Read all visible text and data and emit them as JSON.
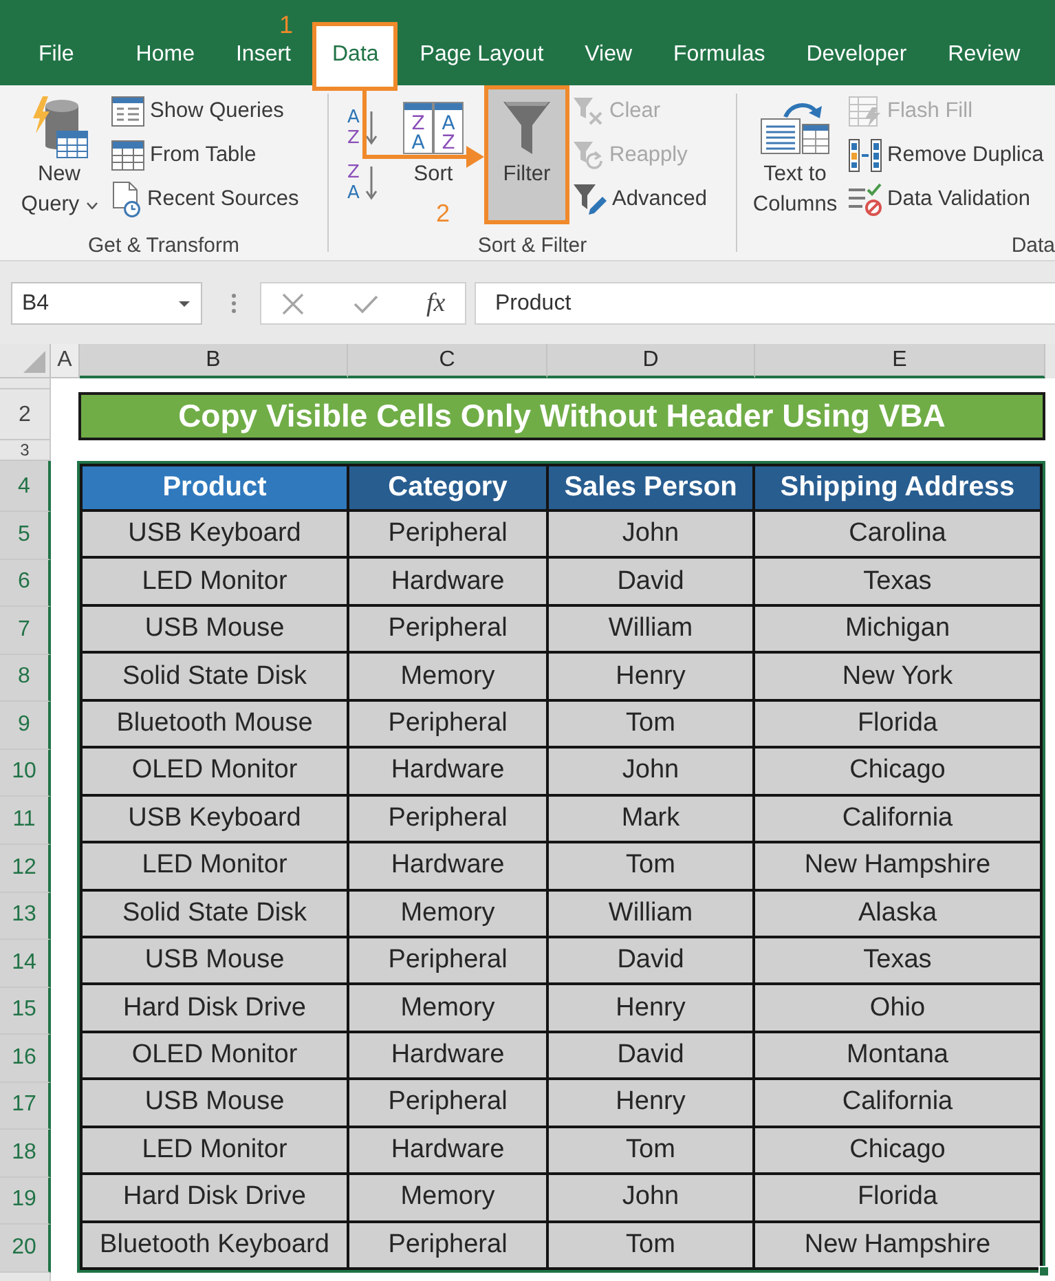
{
  "tabs": [
    {
      "label": "File",
      "selected": false,
      "highlighted": false
    },
    {
      "label": "Home",
      "selected": false,
      "highlighted": false
    },
    {
      "label": "Insert",
      "selected": false,
      "highlighted": false
    },
    {
      "label": "Data",
      "selected": true,
      "highlighted": true
    },
    {
      "label": "Page Layout",
      "selected": false,
      "highlighted": false
    },
    {
      "label": "View",
      "selected": false,
      "highlighted": false
    },
    {
      "label": "Formulas",
      "selected": false,
      "highlighted": false
    },
    {
      "label": "Developer",
      "selected": false,
      "highlighted": false
    },
    {
      "label": "Review",
      "selected": false,
      "highlighted": false
    }
  ],
  "ribbon": {
    "groups": [
      {
        "label": "Get & Transform",
        "controls": [
          {
            "kind": "new_query",
            "lines": [
              "New",
              "Query"
            ],
            "dropdown": true,
            "highlighted": false
          },
          {
            "kind": "stack",
            "buttons": [
              {
                "kind": "show_queries",
                "label": "Show Queries",
                "disabled": false
              },
              {
                "kind": "from_table",
                "label": "From Table",
                "disabled": false
              },
              {
                "kind": "recent_sources",
                "label": "Recent Sources",
                "disabled": false
              }
            ]
          }
        ]
      },
      {
        "label": "Sort & Filter",
        "controls": [
          {
            "kind": "sort_stack",
            "buttons": [
              {
                "kind": "sort_ascending",
                "glyphs": [
                  "A",
                  "Z"
                ]
              },
              {
                "kind": "sort_descending",
                "glyphs": [
                  "Z",
                  "A"
                ]
              }
            ]
          },
          {
            "kind": "sort",
            "glyphs": [
              "Z",
              "A",
              "A",
              "Z"
            ],
            "lines": [
              "Sort"
            ],
            "dropdown": false,
            "highlighted": false
          },
          {
            "kind": "filter",
            "lines": [
              "Filter"
            ],
            "dropdown": false,
            "highlighted": true
          },
          {
            "kind": "stack",
            "buttons": [
              {
                "kind": "clear",
                "label": "Clear",
                "disabled": true
              },
              {
                "kind": "reapply",
                "label": "Reapply",
                "disabled": true
              },
              {
                "kind": "advanced",
                "label": "Advanced",
                "disabled": false
              }
            ]
          }
        ]
      },
      {
        "label": "Data",
        "controls": [
          {
            "kind": "text_to_columns",
            "lines": [
              "Text to",
              "Columns"
            ],
            "dropdown": false,
            "highlighted": false
          },
          {
            "kind": "stack",
            "buttons": [
              {
                "kind": "flash_fill",
                "label": "Flash Fill",
                "disabled": true
              },
              {
                "kind": "remove_duplicates",
                "label": "Remove Duplica",
                "disabled": false
              },
              {
                "kind": "data_validation",
                "label": "Data Validation",
                "disabled": false
              }
            ]
          }
        ]
      }
    ]
  },
  "formula_bar": {
    "name_box": "B4",
    "function_label": "fx",
    "value": "Product"
  },
  "sheet": {
    "column_headers": [
      {
        "label": "A",
        "selected": false
      },
      {
        "label": "B",
        "selected": true
      },
      {
        "label": "C",
        "selected": true
      },
      {
        "label": "D",
        "selected": true
      },
      {
        "label": "E",
        "selected": true
      }
    ],
    "row_headers": [
      {
        "label": "2",
        "selected": false
      },
      {
        "label": "3",
        "selected": false
      },
      {
        "label": "4",
        "selected": true
      },
      {
        "label": "5",
        "selected": true
      },
      {
        "label": "6",
        "selected": true
      },
      {
        "label": "7",
        "selected": true
      },
      {
        "label": "8",
        "selected": true
      },
      {
        "label": "9",
        "selected": true
      },
      {
        "label": "10",
        "selected": true
      },
      {
        "label": "11",
        "selected": true
      },
      {
        "label": "12",
        "selected": true
      },
      {
        "label": "13",
        "selected": true
      },
      {
        "label": "14",
        "selected": true
      },
      {
        "label": "15",
        "selected": true
      },
      {
        "label": "16",
        "selected": true
      },
      {
        "label": "17",
        "selected": true
      },
      {
        "label": "18",
        "selected": true
      },
      {
        "label": "19",
        "selected": true
      },
      {
        "label": "20",
        "selected": true
      }
    ],
    "title": "Copy Visible Cells Only Without Header Using VBA",
    "table": {
      "columns": [
        {
          "label": "Product",
          "active": true
        },
        {
          "label": "Category",
          "active": false
        },
        {
          "label": "Sales Person",
          "active": false
        },
        {
          "label": "Shipping Address",
          "active": false
        }
      ],
      "rows": [
        [
          "USB Keyboard",
          "Peripheral",
          "John",
          "Carolina"
        ],
        [
          "LED Monitor",
          "Hardware",
          "David",
          "Texas"
        ],
        [
          "USB Mouse",
          "Peripheral",
          "William",
          "Michigan"
        ],
        [
          "Solid State Disk",
          "Memory",
          "Henry",
          "New York"
        ],
        [
          "Bluetooth Mouse",
          "Peripheral",
          "Tom",
          "Florida"
        ],
        [
          "OLED Monitor",
          "Hardware",
          "John",
          "Chicago"
        ],
        [
          "USB Keyboard",
          "Peripheral",
          "Mark",
          "California"
        ],
        [
          "LED Monitor",
          "Hardware",
          "Tom",
          "New Hampshire"
        ],
        [
          "Solid State Disk",
          "Memory",
          "William",
          "Alaska"
        ],
        [
          "USB Mouse",
          "Peripheral",
          "David",
          "Texas"
        ],
        [
          "Hard Disk Drive",
          "Memory",
          "Henry",
          "Ohio"
        ],
        [
          "OLED Monitor",
          "Hardware",
          "David",
          "Montana"
        ],
        [
          "USB Mouse",
          "Peripheral",
          "Henry",
          "California"
        ],
        [
          "LED Monitor",
          "Hardware",
          "Tom",
          "Chicago"
        ],
        [
          "Hard Disk Drive",
          "Memory",
          "John",
          "Florida"
        ],
        [
          "Bluetooth Keyboard",
          "Peripheral",
          "Tom",
          "New Hampshire"
        ]
      ]
    }
  },
  "annotations": [
    {
      "label": "1"
    },
    {
      "label": "2"
    }
  ]
}
